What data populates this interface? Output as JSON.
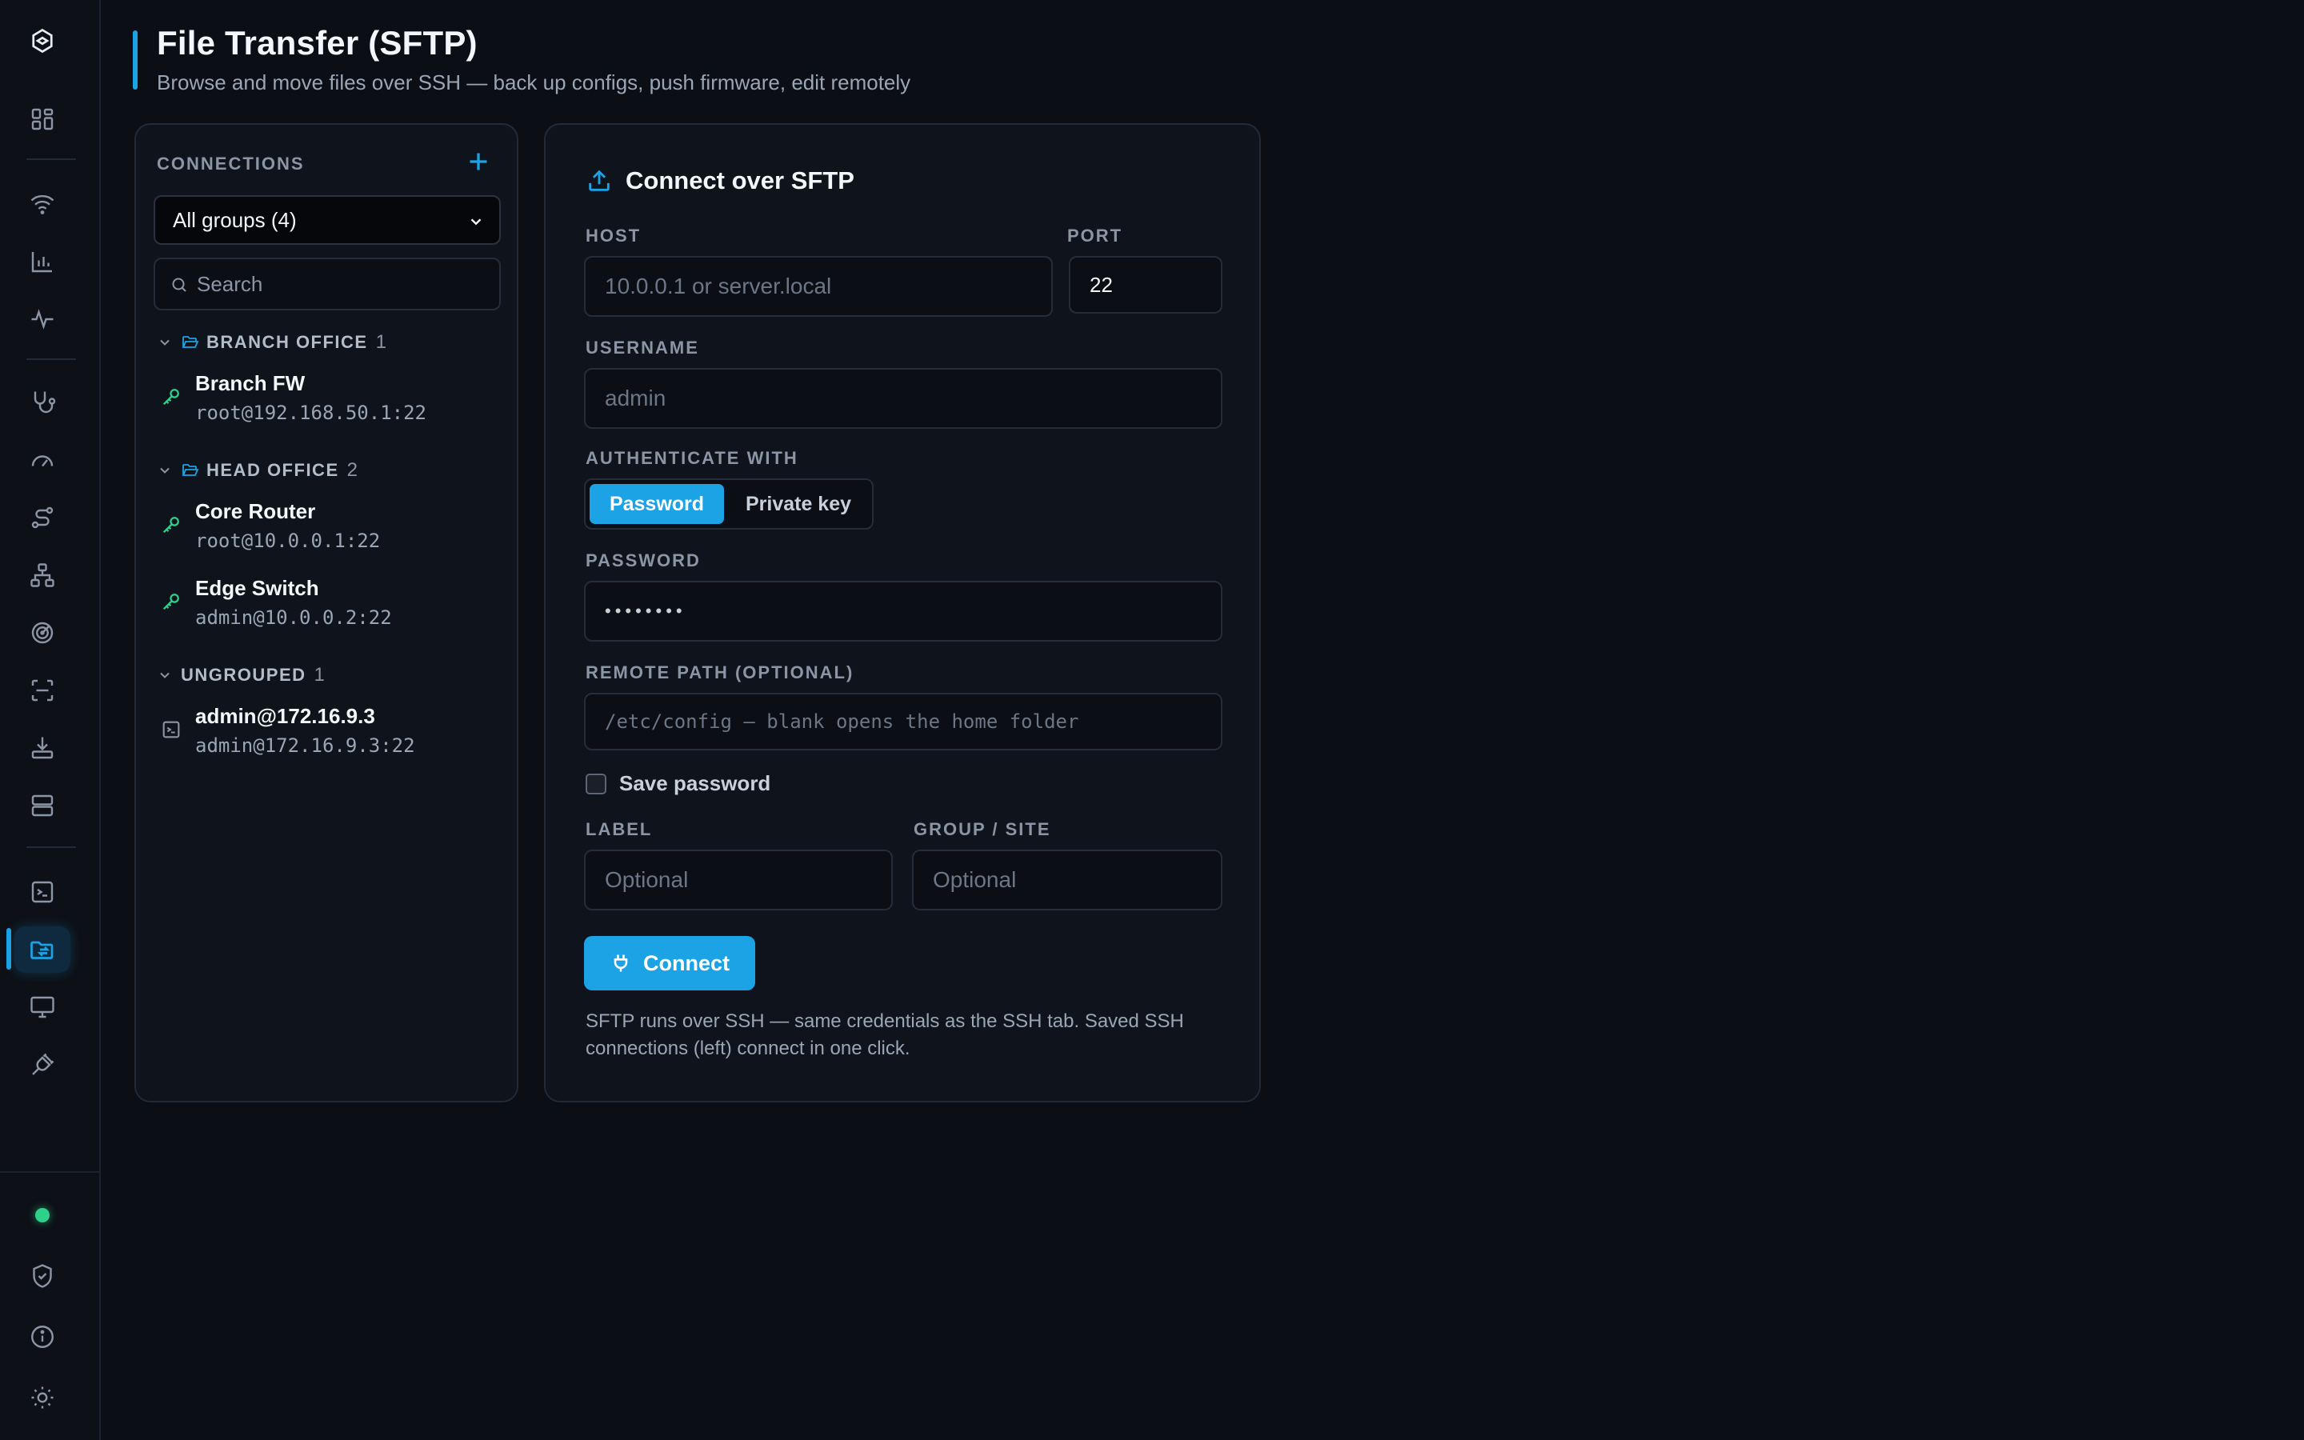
{
  "header": {
    "title": "File Transfer (SFTP)",
    "subtitle": "Browse and move files over SSH — back up configs, push firmware, edit remotely"
  },
  "sidebar": {
    "active_item": "file-transfer",
    "items": [
      {
        "icon": "logo-hexagon-icon"
      },
      {
        "icon": "dashboard-grid-icon"
      },
      {
        "icon": "wifi-icon"
      },
      {
        "icon": "bar-chart-icon"
      },
      {
        "icon": "activity-pulse-icon"
      },
      {
        "icon": "stethoscope-icon"
      },
      {
        "icon": "speedometer-icon"
      },
      {
        "icon": "route-icon"
      },
      {
        "icon": "network-topology-icon"
      },
      {
        "icon": "radar-icon"
      },
      {
        "icon": "scan-icon"
      },
      {
        "icon": "download-tray-icon"
      },
      {
        "icon": "server-icon"
      },
      {
        "icon": "terminal-icon"
      },
      {
        "icon": "folder-transfer-icon"
      },
      {
        "icon": "monitor-icon"
      },
      {
        "icon": "plug-cable-icon"
      },
      {
        "icon": "status-dot-icon"
      },
      {
        "icon": "shield-check-icon"
      },
      {
        "icon": "info-icon"
      },
      {
        "icon": "sun-icon"
      }
    ],
    "status_color": "#2fd08a"
  },
  "connections": {
    "heading": "CONNECTIONS",
    "filter_value": "All groups (4)",
    "search_placeholder": "Search",
    "groups": [
      {
        "name": "BRANCH OFFICE",
        "count": "1",
        "items": [
          {
            "name": "Branch FW",
            "address": "root@192.168.50.1:22",
            "icon": "key-icon"
          }
        ]
      },
      {
        "name": "HEAD OFFICE",
        "count": "2",
        "items": [
          {
            "name": "Core Router",
            "address": "root@10.0.0.1:22",
            "icon": "key-icon"
          },
          {
            "name": "Edge Switch",
            "address": "admin@10.0.0.2:22",
            "icon": "key-icon"
          }
        ]
      },
      {
        "name": "UNGROUPED",
        "count": "1",
        "items": [
          {
            "name": "admin@172.16.9.3",
            "address": "admin@172.16.9.3:22",
            "icon": "terminal-icon"
          }
        ]
      }
    ]
  },
  "form": {
    "title": "Connect over SFTP",
    "host_label": "HOST",
    "host_placeholder": "10.0.0.1 or server.local",
    "port_label": "PORT",
    "port_value": "22",
    "username_label": "USERNAME",
    "username_placeholder": "admin",
    "auth_label": "AUTHENTICATE WITH",
    "auth_options": [
      "Password",
      "Private key"
    ],
    "auth_selected": "Password",
    "password_label": "PASSWORD",
    "password_value": "••••••••",
    "remote_path_label": "REMOTE PATH (OPTIONAL)",
    "remote_path_placeholder": "/etc/config — blank opens the home folder",
    "save_password_label": "Save password",
    "save_password_checked": false,
    "label_label": "LABEL",
    "label_placeholder": "Optional",
    "group_label": "GROUP / SITE",
    "group_placeholder": "Optional",
    "connect_label": "Connect",
    "note": "SFTP runs over SSH — same credentials as the SSH tab. Saved SSH connections (left) connect in one click."
  },
  "colors": {
    "accent": "#1ca3e6",
    "background": "#0b0e14",
    "panel": "#0f141c",
    "key_green": "#2fd08a"
  }
}
